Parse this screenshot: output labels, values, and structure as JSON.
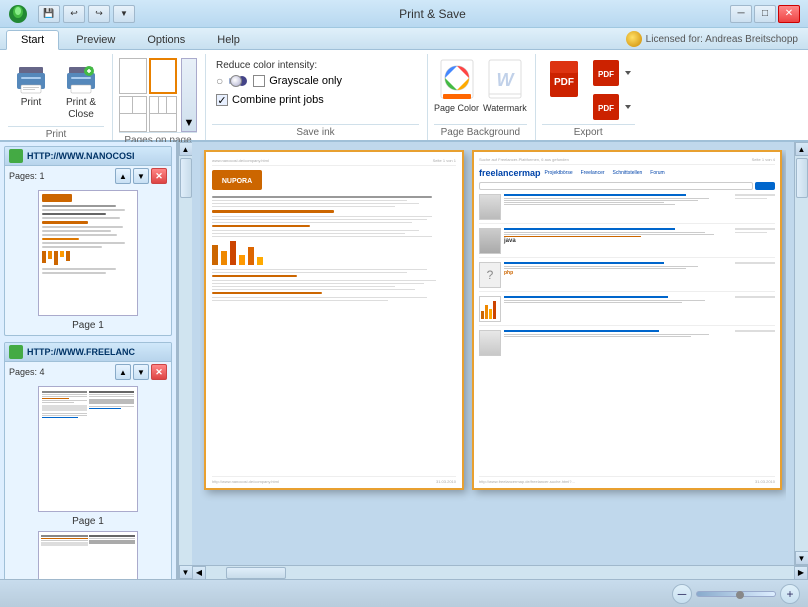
{
  "window": {
    "title": "Print & Save",
    "minimize_label": "─",
    "maximize_label": "□",
    "close_label": "✕"
  },
  "quickaccess": {
    "icons": [
      "save",
      "undo",
      "redo",
      "dropdown"
    ]
  },
  "licensed": {
    "text": "Licensed for: Andreas Breitschopp"
  },
  "tabs": {
    "items": [
      "Start",
      "Preview",
      "Options",
      "Help"
    ],
    "active": 0
  },
  "ribbon": {
    "print_group": {
      "label": "Print",
      "print_btn": "Print",
      "print_close_btn": "Print &\nClose"
    },
    "pages_group": {
      "label": "Pages on page"
    },
    "save_ink_group": {
      "label": "Save ink",
      "reduce_label": "Reduce color intensity:",
      "grayscale_label": "Grayscale only",
      "combine_label": "Combine print jobs"
    },
    "page_bg_group": {
      "label": "Page Background",
      "page_color_label": "Page Color",
      "watermark_label": "Watermark"
    },
    "export_group": {
      "label": "Export"
    }
  },
  "left_panel": {
    "items": [
      {
        "url": "HTTP://WWW.NANOCOSI",
        "pages": "Pages:  1",
        "page_label": "Page 1"
      },
      {
        "url": "HTTP://WWW.FREELANC",
        "pages": "Pages:  4",
        "page_label": "Page 1"
      }
    ]
  },
  "status_bar": {
    "zoom_minus": "─",
    "zoom_plus": "+"
  }
}
